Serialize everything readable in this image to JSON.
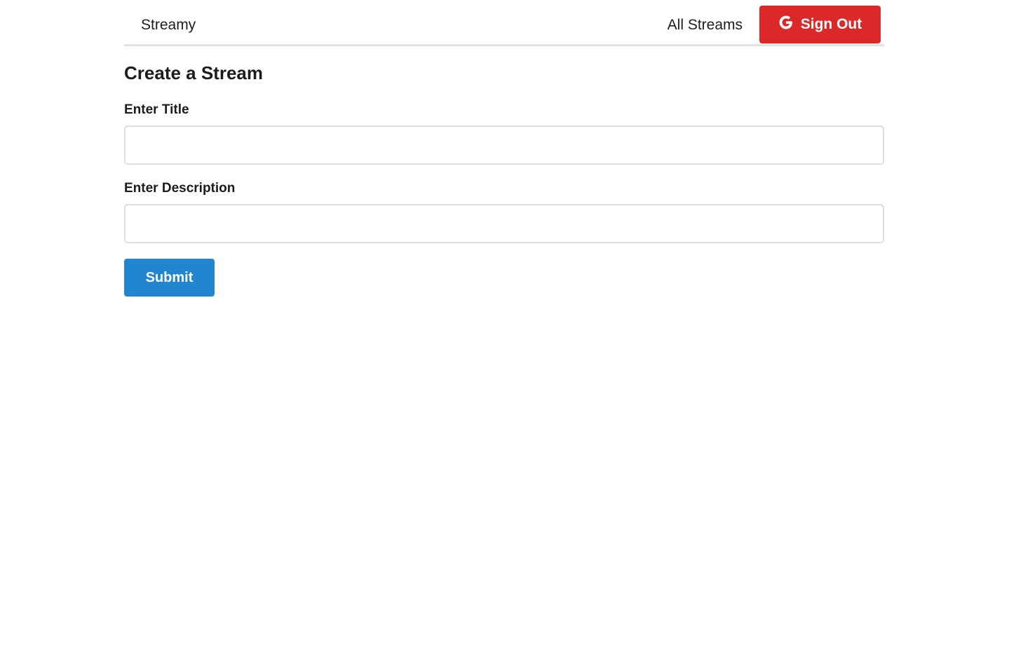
{
  "header": {
    "brand": "Streamy",
    "nav_all_streams": "All Streams",
    "sign_out_label": "Sign Out",
    "sign_out_color": "#db2828",
    "sign_out_icon": "google-icon"
  },
  "form": {
    "title": "Create a Stream",
    "title_label": "Enter Title",
    "title_value": "",
    "description_label": "Enter Description",
    "description_value": "",
    "submit_label": "Submit",
    "submit_color": "#2185d0"
  }
}
